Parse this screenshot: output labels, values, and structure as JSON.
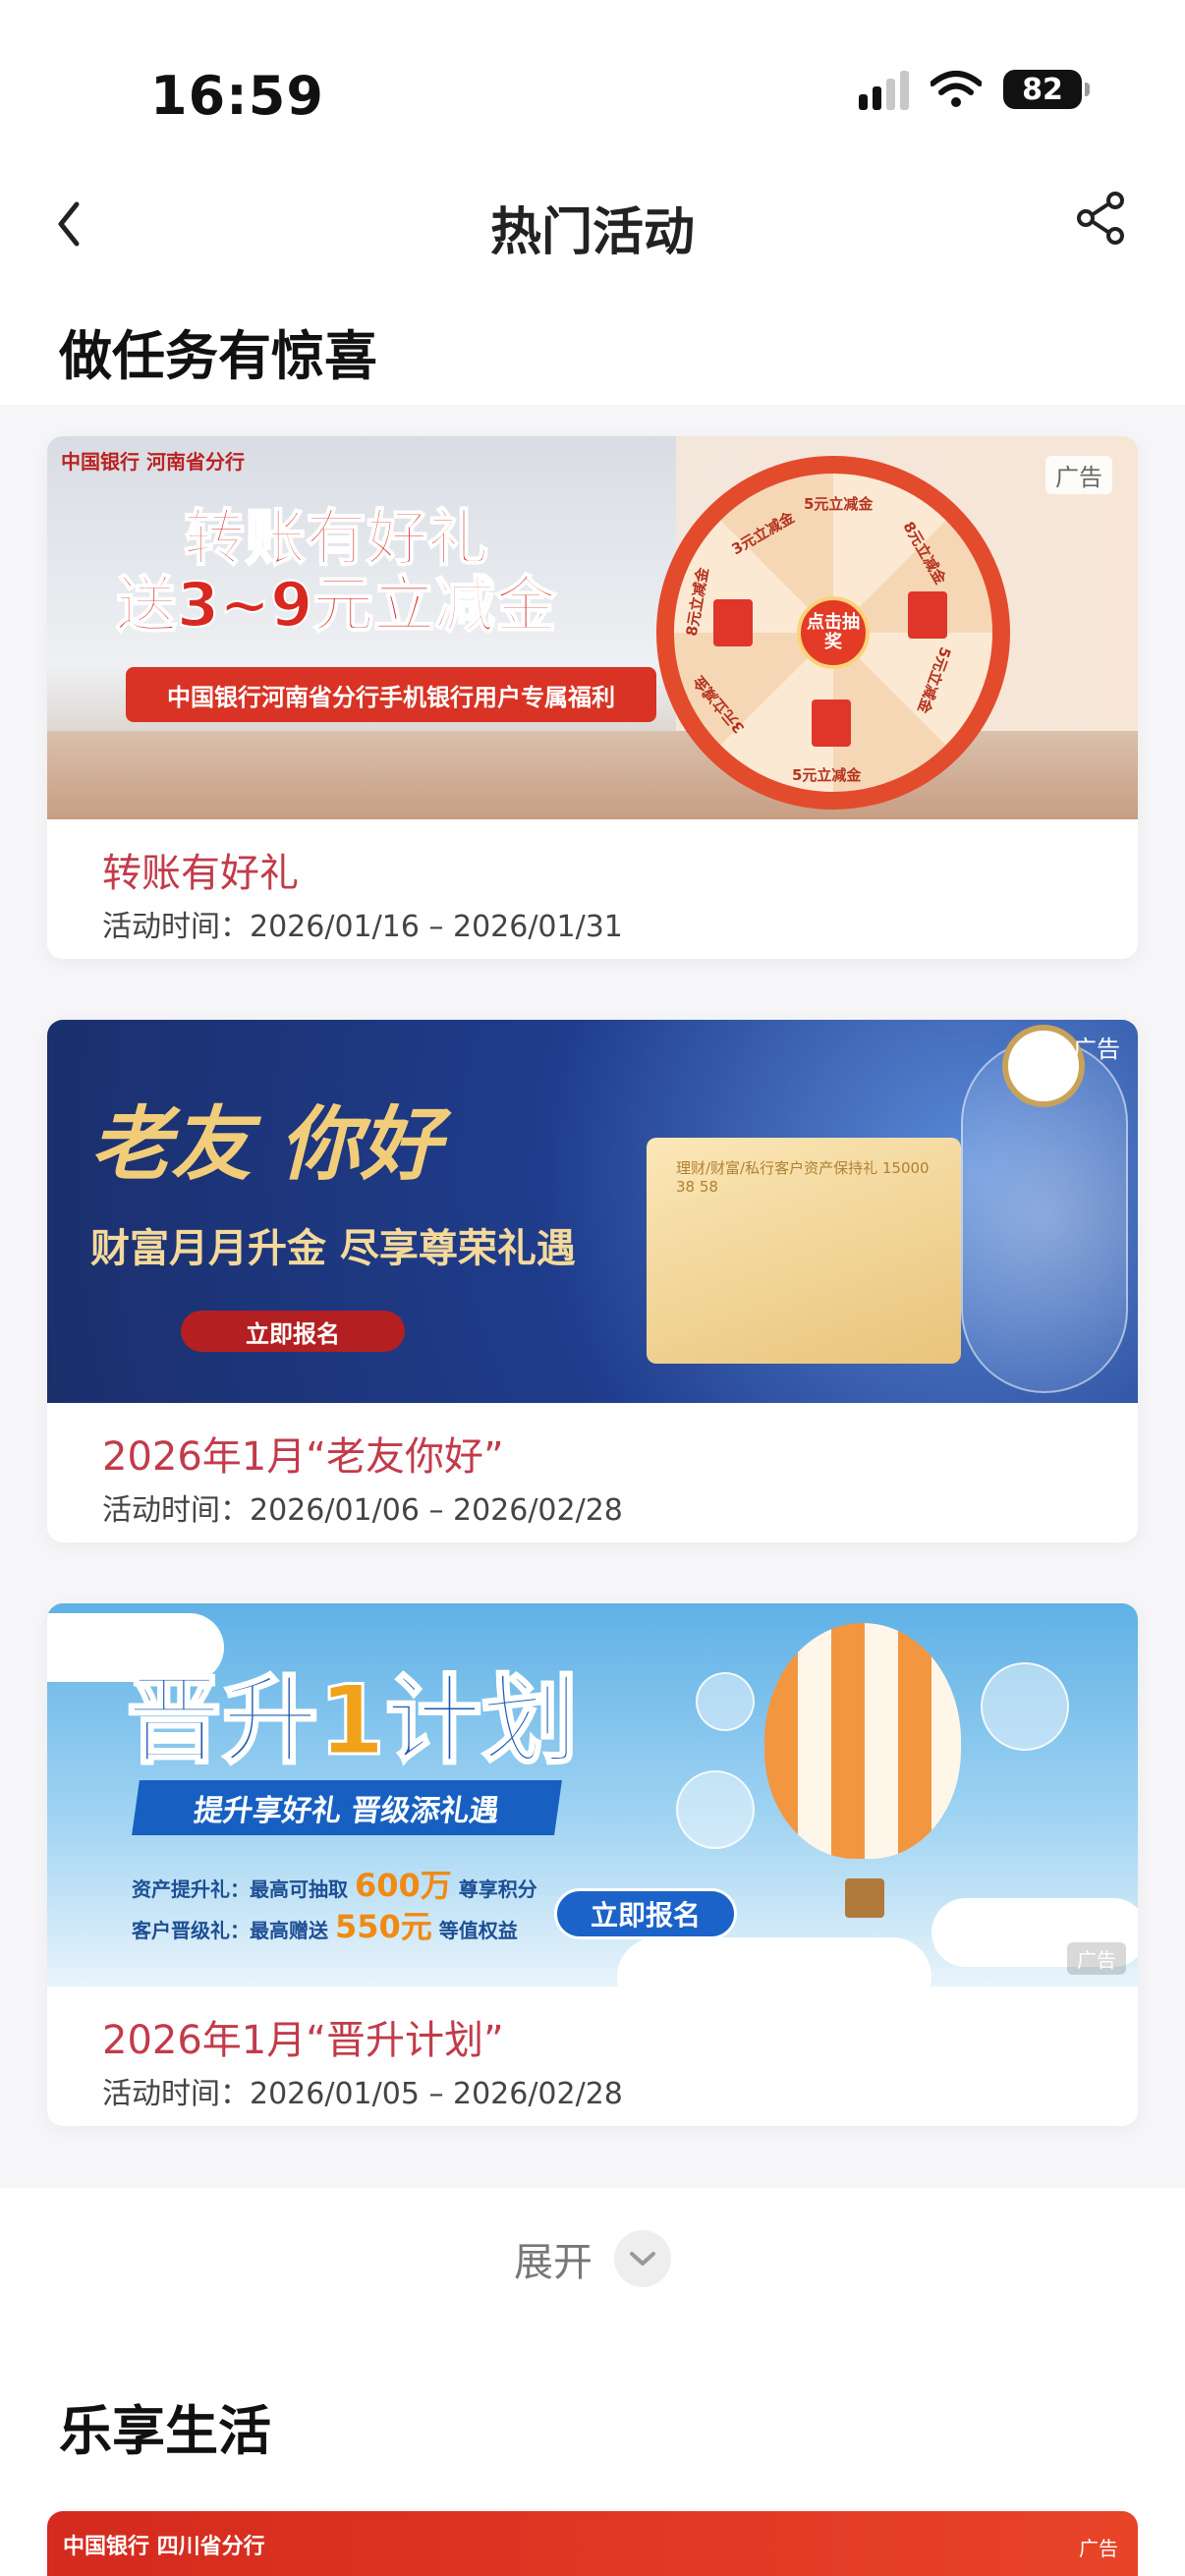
{
  "status_bar": {
    "time": "16:59",
    "battery": "82"
  },
  "nav": {
    "title": "热门活动"
  },
  "sections": [
    {
      "title": "做任务有惊喜"
    },
    {
      "title": "乐享生活"
    }
  ],
  "cards": [
    {
      "title": "转账有好礼",
      "time": "活动时间：2026/01/16 – 2026/01/31",
      "ad": "广告",
      "banner": {
        "bank": "中国银行 河南省分行",
        "line1": "转账有好礼",
        "line2": "送3~9元立减金",
        "ribbon": "中国银行河南省分行手机银行用户专属福利",
        "center": "点击抽奖",
        "labels": [
          "5元立减金",
          "8元立减金",
          "3元立减金",
          "5元立减金",
          "5元立减金",
          "8元立减金",
          "3元立减金",
          "5元立减金"
        ]
      }
    },
    {
      "title": "2026年1月“老友你好”",
      "time": "活动时间：2026/01/06 – 2026/02/28",
      "ad": "广告",
      "banner": {
        "headline": "老友 你好",
        "sub": "财富月月升金  尽享尊荣礼遇",
        "cta": "立即报名",
        "note": "理财/财富/私行客户资产保持礼 15000 38 58"
      }
    },
    {
      "title": "2026年1月“晋升计划”",
      "time": "活动时间：2026/01/05 – 2026/02/28",
      "ad": "广告",
      "banner": {
        "headline_a": "晋升",
        "headline_one": "1",
        "headline_b": "计划",
        "strip": "提升享好礼  晋级添礼遇",
        "line1_a": "资产提升礼：最高可抽取",
        "line1_hl": "600万",
        "line1_b": "尊享积分",
        "line2_a": "客户晋级礼：最高赠送",
        "line2_hl": "550元",
        "line2_b": "等值权益",
        "cta": "立即报名"
      }
    }
  ],
  "expand_label": "展开",
  "bottom_banner": {
    "bank": "中国银行 四川省分行",
    "ad": "广告"
  },
  "colors": {
    "accent_red": "#c23b4a",
    "section_bg": "#f6f6f8"
  },
  "icons": [
    "back-icon",
    "share-icon",
    "wifi-icon",
    "signal-icon",
    "chevron-down-icon"
  ]
}
